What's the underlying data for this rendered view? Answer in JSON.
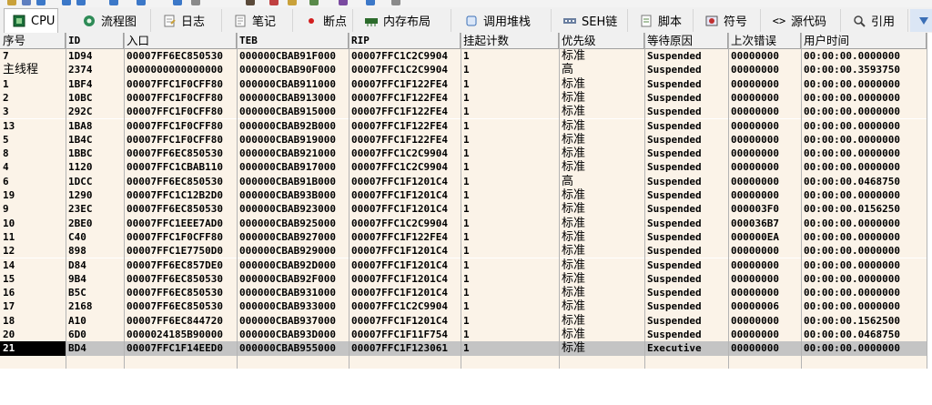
{
  "tabs": [
    {
      "label": "CPU",
      "icon": "cpu-icon",
      "active": true
    },
    {
      "label": "流程图",
      "icon": "graph-icon"
    },
    {
      "label": "日志",
      "icon": "log-icon"
    },
    {
      "label": "笔记",
      "icon": "notes-icon"
    },
    {
      "label": "断点",
      "icon": "breakpoint-icon"
    },
    {
      "label": "内存布局",
      "icon": "memory-map-icon"
    },
    {
      "label": "调用堆栈",
      "icon": "call-stack-icon"
    },
    {
      "label": "SEH链",
      "icon": "seh-icon"
    },
    {
      "label": "脚本",
      "icon": "script-icon"
    },
    {
      "label": "符号",
      "icon": "symbol-icon"
    },
    {
      "label": "源代码",
      "icon": "source-icon"
    },
    {
      "label": "引用",
      "icon": "references-icon"
    }
  ],
  "columns": [
    "序号",
    "ID",
    "入口",
    "TEB",
    "RIP",
    "挂起计数",
    "优先级",
    "等待原因",
    "上次错误",
    "用户时间"
  ],
  "rows": [
    [
      "7",
      "1D94",
      "00007FF6EC850530",
      "000000CBAB91F000",
      "00007FFC1C2C9904",
      "1",
      "标准",
      "Suspended",
      "00000000",
      "00:00:00.0000000"
    ],
    [
      "主线程",
      "2374",
      "0000000000000000",
      "000000CBAB90F000",
      "00007FFC1C2C9904",
      "1",
      "高",
      "Suspended",
      "00000000",
      "00:00:00.3593750"
    ],
    [
      "1",
      "1BF4",
      "00007FFC1F0CFF80",
      "000000CBAB911000",
      "00007FFC1F122FE4",
      "1",
      "标准",
      "Suspended",
      "00000000",
      "00:00:00.0000000"
    ],
    [
      "2",
      "10BC",
      "00007FFC1F0CFF80",
      "000000CBAB913000",
      "00007FFC1F122FE4",
      "1",
      "标准",
      "Suspended",
      "00000000",
      "00:00:00.0000000"
    ],
    [
      "3",
      "292C",
      "00007FFC1F0CFF80",
      "000000CBAB915000",
      "00007FFC1F122FE4",
      "1",
      "标准",
      "Suspended",
      "00000000",
      "00:00:00.0000000"
    ],
    [
      "13",
      "1BA8",
      "00007FFC1F0CFF80",
      "000000CBAB92B000",
      "00007FFC1F122FE4",
      "1",
      "标准",
      "Suspended",
      "00000000",
      "00:00:00.0000000"
    ],
    [
      "5",
      "1B4C",
      "00007FFC1F0CFF80",
      "000000CBAB919000",
      "00007FFC1F122FE4",
      "1",
      "标准",
      "Suspended",
      "00000000",
      "00:00:00.0000000"
    ],
    [
      "8",
      "1BBC",
      "00007FF6EC850530",
      "000000CBAB921000",
      "00007FFC1C2C9904",
      "1",
      "标准",
      "Suspended",
      "00000000",
      "00:00:00.0000000"
    ],
    [
      "4",
      "1120",
      "00007FFC1CBAB110",
      "000000CBAB917000",
      "00007FFC1C2C9904",
      "1",
      "标准",
      "Suspended",
      "00000000",
      "00:00:00.0000000"
    ],
    [
      "6",
      "1DCC",
      "00007FF6EC850530",
      "000000CBAB91B000",
      "00007FFC1F1201C4",
      "1",
      "高",
      "Suspended",
      "00000000",
      "00:00:00.0468750"
    ],
    [
      "19",
      "1290",
      "00007FFC1C12B2D0",
      "000000CBAB93B000",
      "00007FFC1F1201C4",
      "1",
      "标准",
      "Suspended",
      "00000000",
      "00:00:00.0000000"
    ],
    [
      "9",
      "23EC",
      "00007FF6EC850530",
      "000000CBAB923000",
      "00007FFC1F1201C4",
      "1",
      "标准",
      "Suspended",
      "000003F0",
      "00:00:00.0156250"
    ],
    [
      "10",
      "2BE0",
      "00007FFC1EEE7AD0",
      "000000CBAB925000",
      "00007FFC1C2C9904",
      "1",
      "标准",
      "Suspended",
      "000036B7",
      "00:00:00.0000000"
    ],
    [
      "11",
      "C40",
      "00007FFC1F0CFF80",
      "000000CBAB927000",
      "00007FFC1F122FE4",
      "1",
      "标准",
      "Suspended",
      "000000EA",
      "00:00:00.0000000"
    ],
    [
      "12",
      "898",
      "00007FFC1E7750D0",
      "000000CBAB929000",
      "00007FFC1F1201C4",
      "1",
      "标准",
      "Suspended",
      "00000000",
      "00:00:00.0000000"
    ],
    [
      "14",
      "D84",
      "00007FF6EC857DE0",
      "000000CBAB92D000",
      "00007FFC1F1201C4",
      "1",
      "标准",
      "Suspended",
      "00000000",
      "00:00:00.0000000"
    ],
    [
      "15",
      "9B4",
      "00007FF6EC850530",
      "000000CBAB92F000",
      "00007FFC1F1201C4",
      "1",
      "标准",
      "Suspended",
      "00000000",
      "00:00:00.0000000"
    ],
    [
      "16",
      "B5C",
      "00007FF6EC850530",
      "000000CBAB931000",
      "00007FFC1F1201C4",
      "1",
      "标准",
      "Suspended",
      "00000000",
      "00:00:00.0000000"
    ],
    [
      "17",
      "2168",
      "00007FF6EC850530",
      "000000CBAB933000",
      "00007FFC1C2C9904",
      "1",
      "标准",
      "Suspended",
      "00000006",
      "00:00:00.0000000"
    ],
    [
      "18",
      "A10",
      "00007FF6EC844720",
      "000000CBAB937000",
      "00007FFC1F1201C4",
      "1",
      "标准",
      "Suspended",
      "00000000",
      "00:00:00.1562500"
    ],
    [
      "20",
      "6D0",
      "0000024185B90000",
      "000000CBAB93D000",
      "00007FFC1F11F754",
      "1",
      "标准",
      "Suspended",
      "00000000",
      "00:00:00.0468750"
    ],
    [
      "21",
      "BD4",
      "00007FFC1F14EED0",
      "000000CBAB955000",
      "00007FFC1F123061",
      "1",
      "标准",
      "Executive",
      "00000000",
      "00:00:00.0000000"
    ]
  ],
  "selected_row_index": 21,
  "colors": {
    "row_bg": "#fbf3e8",
    "selected_bg": "#c4c4c4",
    "header_bg": "#f0f0f0"
  }
}
